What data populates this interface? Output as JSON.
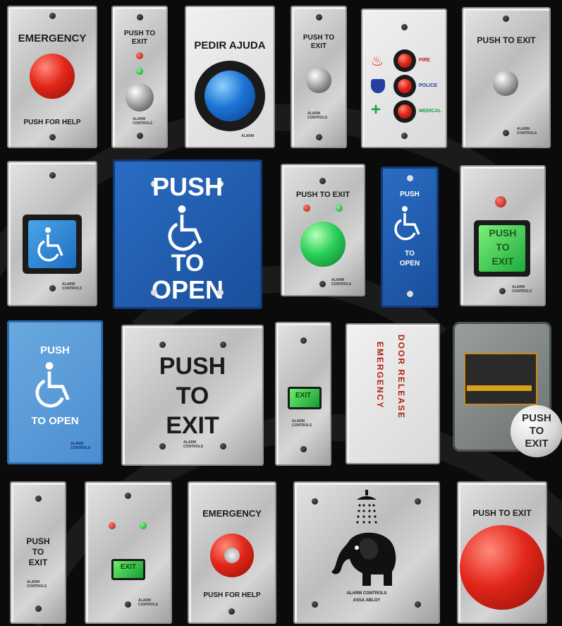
{
  "row1": {
    "emergency_top": "EMERGENCY",
    "emergency_bottom": "PUSH FOR HELP",
    "push_to_exit_small_1": "PUSH TO",
    "push_to_exit_small_2": "EXIT",
    "pedir": "PEDIR AJUDA",
    "push_to_exit_b_1": "PUSH TO",
    "push_to_exit_b_2": "EXIT",
    "fire": "FIRE",
    "police": "POLICE",
    "medical": "MEDICAL",
    "push_to_exit_wide": "PUSH TO EXIT"
  },
  "row2": {
    "big_push": "PUSH",
    "big_to": "TO",
    "big_open": "OPEN",
    "push_to_exit_green": "PUSH TO EXIT",
    "narrow_push": "PUSH",
    "narrow_to": "TO",
    "narrow_open": "OPEN",
    "square_push": "PUSH",
    "square_to": "TO",
    "square_exit": "EXIT"
  },
  "row3": {
    "lb_push": "PUSH",
    "lb_open": "TO OPEN",
    "pte_push": "PUSH",
    "pte_to": "TO",
    "pte_exit": "EXIT",
    "small_exit": "EXIT",
    "emergency_vertical": "EMERGENCY",
    "door_release_vertical": "DOOR RELEASE",
    "disc_push": "PUSH",
    "disc_to": "TO",
    "disc_exit": "EXIT"
  },
  "row4": {
    "p_push": "PUSH",
    "p_to": "TO",
    "p_exit": "EXIT",
    "green_exit": "EXIT",
    "emergency_key_top": "EMERGENCY",
    "emergency_key_bottom": "PUSH FOR HELP",
    "alarm_controls": "ALARM CONTROLS",
    "assa": "ASSA ABLOY",
    "mushroom_label": "PUSH TO EXIT"
  },
  "brand": {
    "logo_line1": "ALARM",
    "logo_line2": "CONTROLS",
    "logo_line3": "ASSA ABLOY"
  },
  "colors": {
    "background": "#0b0b0b",
    "red": "#e3261a",
    "green": "#2ad05a",
    "blue": "#1d74d6",
    "plate_blue": "#2a6dc4"
  }
}
